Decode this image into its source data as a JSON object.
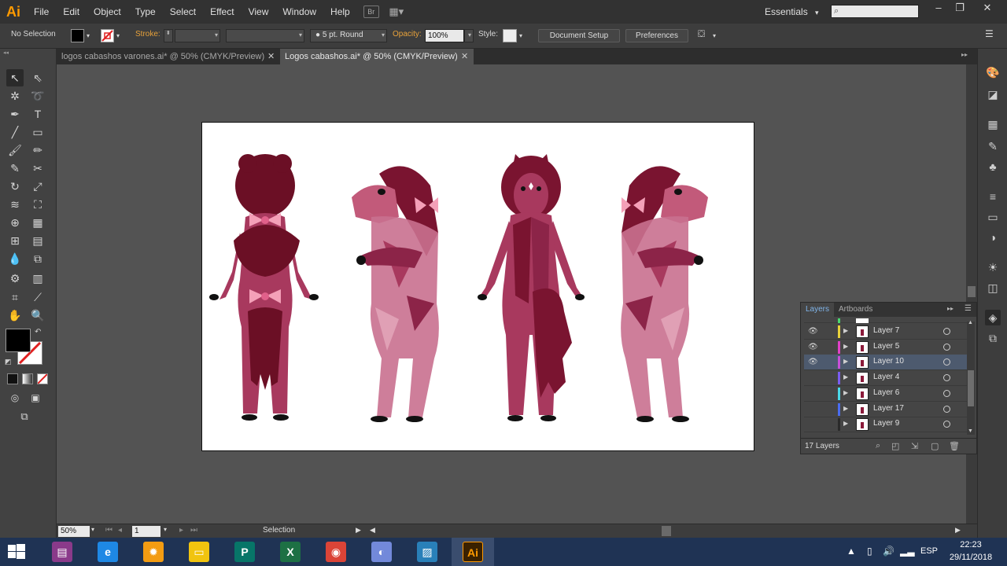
{
  "app": {
    "logo": "Ai"
  },
  "menu": [
    "File",
    "Edit",
    "Object",
    "Type",
    "Select",
    "Effect",
    "View",
    "Window",
    "Help"
  ],
  "menubar_chips": {
    "bridge": "Br",
    "arrange": "▦▾"
  },
  "workspace": {
    "label": "Essentials",
    "arrow": "▾"
  },
  "search": {
    "placeholder": "",
    "icon": "search-icon"
  },
  "window_controls": {
    "minimize": "–",
    "restore": "❐",
    "close": "✕"
  },
  "control_bar": {
    "selection_label": "No Selection",
    "stroke_label": "Stroke:",
    "brush_value": "5 pt. Round",
    "opacity_label": "Opacity:",
    "opacity_value": "100%",
    "style_label": "Style:",
    "document_setup": "Document Setup",
    "preferences": "Preferences"
  },
  "tabs": [
    {
      "label": "logos cabashos varones.ai* @ 50% (CMYK/Preview)",
      "active": false
    },
    {
      "label": "Logos cabashos.ai* @ 50% (CMYK/Preview)",
      "active": true
    }
  ],
  "layers_panel": {
    "tabs": [
      "Layers",
      "Artboards"
    ],
    "rows": [
      {
        "name": "Layer 7",
        "color": "#e8d23a",
        "visible": true,
        "selected": false
      },
      {
        "name": "Layer 5",
        "color": "#e040c8",
        "visible": true,
        "selected": false
      },
      {
        "name": "Layer 10",
        "color": "#c84fd8",
        "visible": true,
        "selected": true
      },
      {
        "name": "Layer 4",
        "color": "#7a5cf0",
        "visible": false,
        "selected": false
      },
      {
        "name": "Layer 6",
        "color": "#4ad8e8",
        "visible": false,
        "selected": false
      },
      {
        "name": "Layer 17",
        "color": "#4a6cf0",
        "visible": false,
        "selected": false
      },
      {
        "name": "Layer 9",
        "color": "#2a2a2a",
        "visible": false,
        "selected": false
      }
    ],
    "layer_count": "17 Layers"
  },
  "status_bar": {
    "zoom": "50%",
    "artboard_number": "1",
    "tool": "Selection"
  },
  "taskbar": {
    "apps": [
      {
        "name": "winrar",
        "label": "▤",
        "color": "#8a3a8a",
        "active": false
      },
      {
        "name": "internet-explorer",
        "label": "e",
        "color": "#1e88e5",
        "active": false
      },
      {
        "name": "settings-app",
        "label": "✹",
        "color": "#f39c12",
        "active": false
      },
      {
        "name": "file-explorer",
        "label": "▭",
        "color": "#f1c40f",
        "active": false
      },
      {
        "name": "publisher",
        "label": "P",
        "color": "#077568",
        "active": false
      },
      {
        "name": "excel",
        "label": "X",
        "color": "#1d7044",
        "active": false
      },
      {
        "name": "chrome",
        "label": "◉",
        "color": "#db4437",
        "active": false
      },
      {
        "name": "discord",
        "label": "◐",
        "color": "#7289da",
        "active": false
      },
      {
        "name": "photos",
        "label": "▨",
        "color": "#2980b9",
        "active": false
      },
      {
        "name": "illustrator",
        "label": "Ai",
        "color": "#3a2100",
        "active": true
      }
    ],
    "language": "ESP",
    "time": "22:23",
    "date": "29/11/2018"
  }
}
